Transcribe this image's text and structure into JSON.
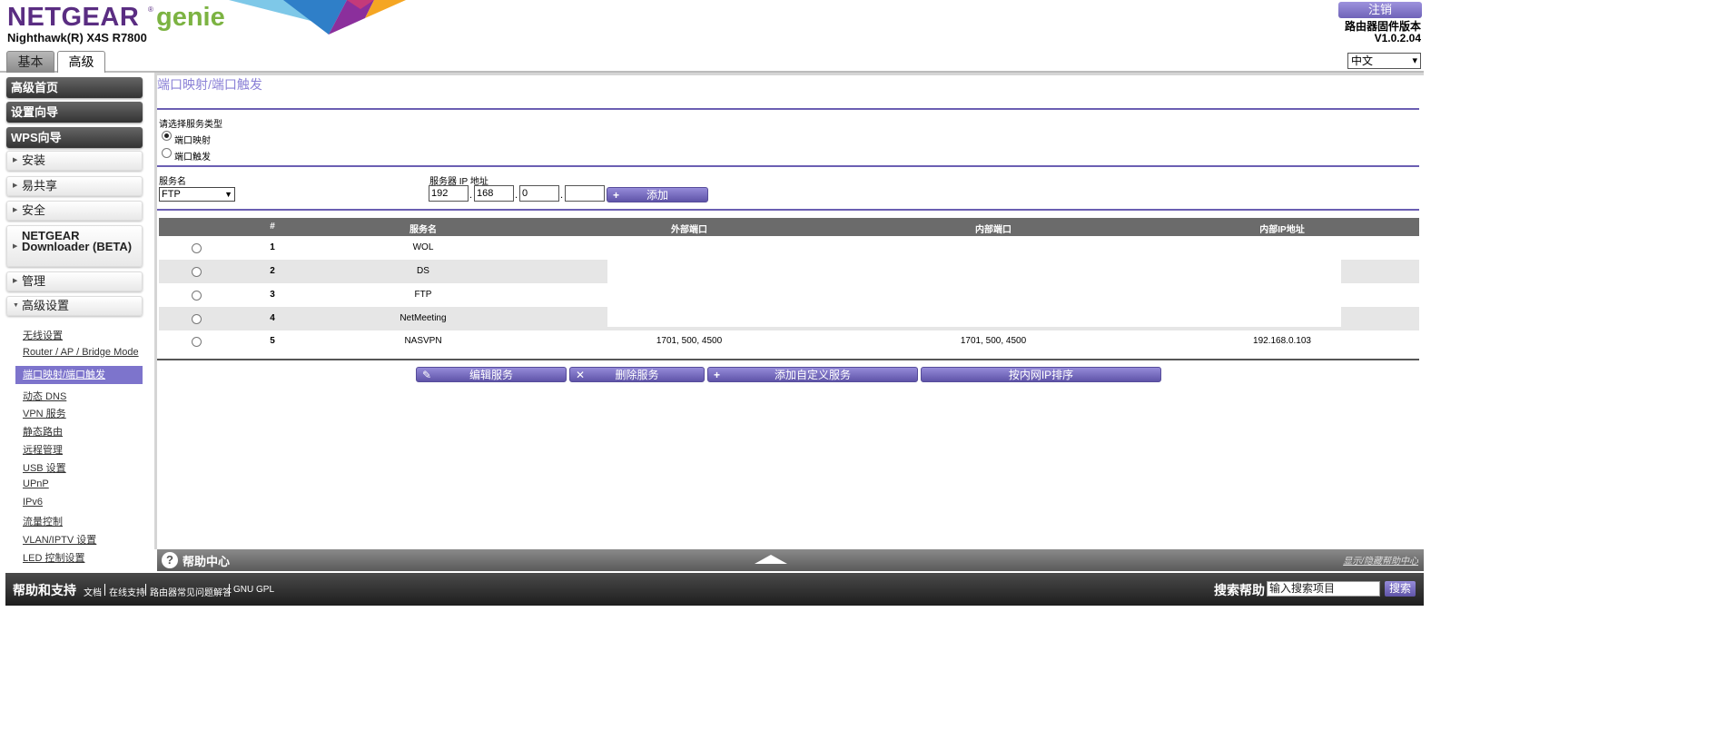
{
  "header": {
    "brand": "NETGEAR",
    "brand_suffix": "genie",
    "reg_mark": "®",
    "model": "Nighthawk(R) X4S R7800",
    "logout": "注销",
    "firmware_label": "路由器固件版本",
    "firmware_version": "V1.0.2.04",
    "language": "中文"
  },
  "tabs": {
    "basic": "基本",
    "advanced": "高级"
  },
  "sidebar": {
    "dark_items": [
      "高级首页",
      "设置向导",
      "WPS向导"
    ],
    "light_items": [
      "安装",
      "易共享",
      "安全",
      "NETGEAR Downloader (BETA)",
      "管理",
      "高级设置"
    ],
    "sub_items": [
      "无线设置",
      "Router / AP / Bridge Mode",
      "端口映射/端口触发",
      "动态 DNS",
      "VPN 服务",
      "静态路由",
      "远程管理",
      "USB 设置",
      "UPnP",
      "IPv6",
      "流量控制",
      "VLAN/IPTV 设置",
      "LED 控制设置"
    ],
    "active_sub": "端口映射/端口触发"
  },
  "page": {
    "title": "端口映射/端口触发",
    "service_type_label": "请选择服务类型",
    "option_forward": "端口映射",
    "option_trigger": "端口触发",
    "service_name_label": "服务名",
    "service_name_value": "FTP",
    "server_ip_label": "服务器 IP 地址",
    "ip": [
      "192",
      "168",
      "0",
      ""
    ],
    "add_button": "添加"
  },
  "table": {
    "headers": [
      "#",
      "服务名",
      "外部端口",
      "内部端口",
      "内部IP地址"
    ],
    "rows": [
      {
        "num": "1",
        "name": "WOL",
        "ext": "",
        "int": "",
        "ip": ""
      },
      {
        "num": "2",
        "name": "DS",
        "ext": "",
        "int": "",
        "ip": ""
      },
      {
        "num": "3",
        "name": "FTP",
        "ext": "",
        "int": "",
        "ip": ""
      },
      {
        "num": "4",
        "name": "NetMeeting",
        "ext": "",
        "int": "",
        "ip": ""
      },
      {
        "num": "5",
        "name": "NASVPN",
        "ext": "1701, 500, 4500",
        "int": "1701, 500, 4500",
        "ip": "192.168.0.103"
      }
    ]
  },
  "actions": {
    "edit": "编辑服务",
    "delete": "删除服务",
    "add_custom": "添加自定义服务",
    "sort_ip": "按内网IP排序"
  },
  "help": {
    "center": "帮助中心",
    "toggle": "显示/隐藏帮助中心"
  },
  "footer": {
    "title": "帮助和支持",
    "links": [
      "文档",
      "在线支持",
      "路由器常见问题解答",
      "GNU GPL"
    ],
    "search_label": "搜索帮助",
    "search_placeholder": "输入搜索项目",
    "search_button": "搜索"
  }
}
